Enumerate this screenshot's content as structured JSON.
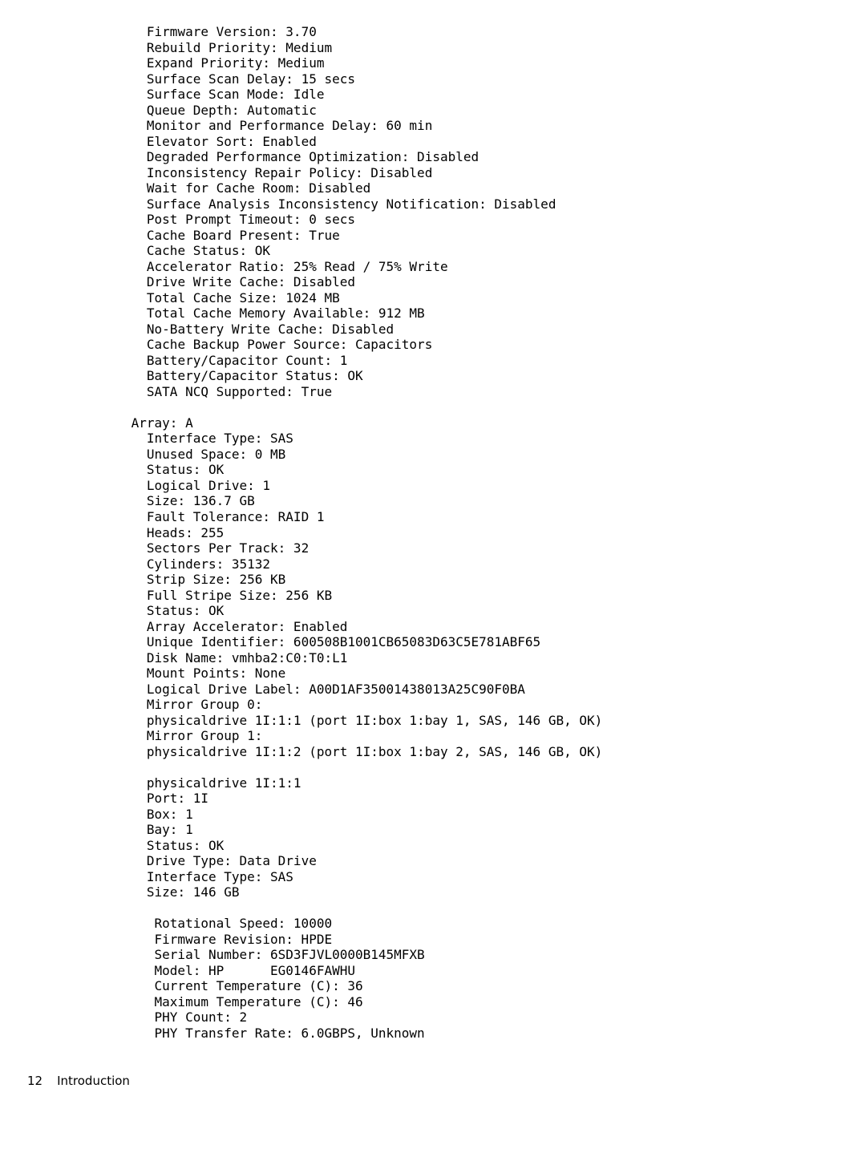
{
  "footer": {
    "page": "12",
    "section": "Introduction"
  },
  "controller": {
    "FirmwareVersion": "Firmware Version: 3.70",
    "RebuildPriority": "Rebuild Priority: Medium",
    "ExpandPriority": "Expand Priority: Medium",
    "SurfaceScanDelay": "Surface Scan Delay: 15 secs",
    "SurfaceScanMode": "Surface Scan Mode: Idle",
    "QueueDepth": "Queue Depth: Automatic",
    "MonitorPerfDelay": "Monitor and Performance Delay: 60 min",
    "ElevatorSort": "Elevator Sort: Enabled",
    "DegradedPerfOpt": "Degraded Performance Optimization: Disabled",
    "InconsistencyRepair": "Inconsistency Repair Policy: Disabled",
    "WaitCacheRoom": "Wait for Cache Room: Disabled",
    "SurfaceAnalysisNotif": "Surface Analysis Inconsistency Notification: Disabled",
    "PostPromptTimeout": "Post Prompt Timeout: 0 secs",
    "CacheBoardPresent": "Cache Board Present: True",
    "CacheStatus": "Cache Status: OK",
    "AcceleratorRatio": "Accelerator Ratio: 25% Read / 75% Write",
    "DriveWriteCache": "Drive Write Cache: Disabled",
    "TotalCacheSize": "Total Cache Size: 1024 MB",
    "TotalCacheMemAvail": "Total Cache Memory Available: 912 MB",
    "NoBatteryWriteCache": "No-Battery Write Cache: Disabled",
    "CacheBackupSrc": "Cache Backup Power Source: Capacitors",
    "BattCapCount": "Battery/Capacitor Count: 1",
    "BattCapStatus": "Battery/Capacitor Status: OK",
    "SATANCQ": "SATA NCQ Supported: True"
  },
  "array": {
    "_header": "Array: A",
    "InterfaceType": "Interface Type: SAS",
    "UnusedSpace": "Unused Space: 0 MB",
    "Status1": "Status: OK",
    "LogicalDrive": "Logical Drive: 1",
    "Size": "Size: 136.7 GB",
    "FaultTolerance": "Fault Tolerance: RAID 1",
    "Heads": "Heads: 255",
    "SectorsPerTrack": "Sectors Per Track: 32",
    "Cylinders": "Cylinders: 35132",
    "StripSize": "Strip Size: 256 KB",
    "FullStripeSize": "Full Stripe Size: 256 KB",
    "Status2": "Status: OK",
    "ArrayAccelerator": "Array Accelerator: Enabled",
    "UniqueIdentifier": "Unique Identifier: 600508B1001CB65083D63C5E781ABF65",
    "DiskName": "Disk Name: vmhba2:C0:T0:L1",
    "MountPoints": "Mount Points: None",
    "LogicalDriveLabel": "Logical Drive Label: A00D1AF35001438013A25C90F0BA",
    "MirrorGroup0": "Mirror Group 0:",
    "PD_MG0": "physicaldrive 1I:1:1 (port 1I:box 1:bay 1, SAS, 146 GB, OK)",
    "MirrorGroup1": "Mirror Group 1:",
    "PD_MG1": "physicaldrive 1I:1:2 (port 1I:box 1:bay 2, SAS, 146 GB, OK)"
  },
  "pd": {
    "_header": "physicaldrive 1I:1:1",
    "Port": "Port: 1I",
    "Box": "Box: 1",
    "Bay": "Bay: 1",
    "Status": "Status: OK",
    "DriveType": "Drive Type: Data Drive",
    "InterfaceType": "Interface Type: SAS",
    "Size": "Size: 146 GB",
    "RotationalSpeed": "Rotational Speed: 10000",
    "FirmwareRev": "Firmware Revision: HPDE",
    "SerialNumber": "Serial Number: 6SD3FJVL0000B145MFXB",
    "Model": "Model: HP      EG0146FAWHU",
    "CurrentTemp": "Current Temperature (C): 36",
    "MaxTemp": "Maximum Temperature (C): 46",
    "PHYCount": "PHY Count: 2",
    "PHYTransferRate": "PHY Transfer Rate: 6.0GBPS, Unknown"
  }
}
